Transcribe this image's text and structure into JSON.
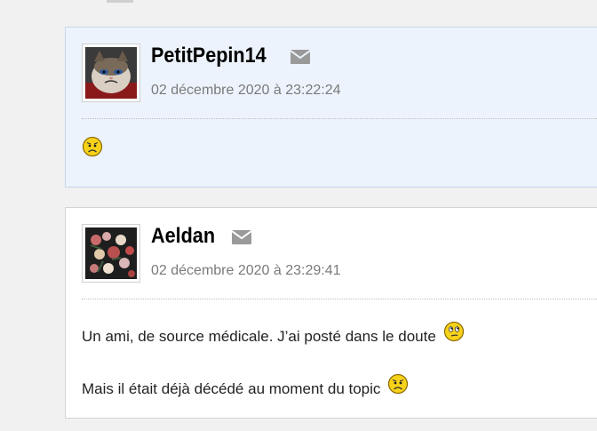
{
  "posts": [
    {
      "author": "PetitPepin14",
      "date": "02 décembre 2020 à 23:22:24",
      "lines": [],
      "smiley_only": "sad-face-icon",
      "avatar_icon": "cat-avatar-icon"
    },
    {
      "author": "Aeldan",
      "date": "02 décembre 2020 à 23:29:41",
      "lines": [
        "Un ami, de source médicale. J’ai posté dans le doute",
        "Mais il était déjà décédé au moment du topic"
      ],
      "line_icons": [
        "thinking-face-icon",
        "sad-face-icon"
      ],
      "avatar_icon": "flowers-avatar-icon"
    }
  ],
  "colors": {
    "post_highlight_bg": "#edf3fc",
    "post_bg": "#ffffff",
    "page_bg": "#f1f1f1",
    "date_text": "#7a7a7a",
    "mail_icon": "#9a9a9a"
  }
}
